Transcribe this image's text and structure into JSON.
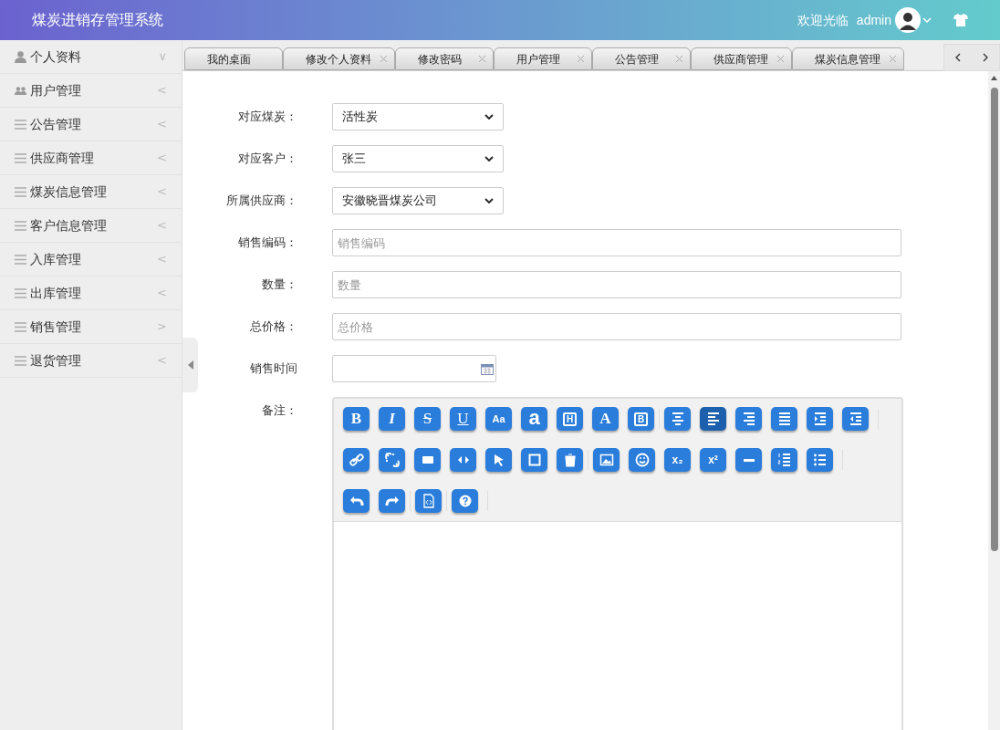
{
  "header": {
    "title": "煤炭进销存管理系统",
    "welcome": "欢迎光临",
    "username": "admin"
  },
  "sidebar": {
    "items": [
      {
        "kind": "user",
        "label": "个人资料",
        "chevron": "∨"
      },
      {
        "kind": "users",
        "label": "用户管理",
        "chevron": "<"
      },
      {
        "kind": "list",
        "label": "公告管理",
        "chevron": "<"
      },
      {
        "kind": "list",
        "label": "供应商管理",
        "chevron": "<"
      },
      {
        "kind": "list",
        "label": "煤炭信息管理",
        "chevron": "<"
      },
      {
        "kind": "list",
        "label": "客户信息管理",
        "chevron": "<"
      },
      {
        "kind": "list",
        "label": "入库管理",
        "chevron": "<"
      },
      {
        "kind": "list",
        "label": "出库管理",
        "chevron": "<"
      },
      {
        "kind": "list",
        "label": "销售管理",
        "chevron": ">"
      },
      {
        "kind": "list",
        "label": "退货管理",
        "chevron": "<"
      }
    ]
  },
  "tabs": [
    {
      "label": "我的桌面",
      "closable": false
    },
    {
      "label": "修改个人资料",
      "closable": true
    },
    {
      "label": "修改密码",
      "closable": true
    },
    {
      "label": "用户管理",
      "closable": true
    },
    {
      "label": "公告管理",
      "closable": true
    },
    {
      "label": "供应商管理",
      "closable": true
    },
    {
      "label": "煤炭信息管理",
      "closable": true
    }
  ],
  "form": {
    "fields": [
      {
        "kind": "select",
        "label": "对应煤炭：",
        "value": "活性炭"
      },
      {
        "kind": "select",
        "label": "对应客户：",
        "value": "张三"
      },
      {
        "kind": "select",
        "label": "所属供应商：",
        "value": "安徽晓晋煤炭公司"
      },
      {
        "kind": "input",
        "label": "销售编码：",
        "placeholder": "销售编码"
      },
      {
        "kind": "input",
        "label": "数量：",
        "placeholder": "数量"
      },
      {
        "kind": "input",
        "label": "总价格：",
        "placeholder": "总价格"
      },
      {
        "kind": "date",
        "label": "销售时间"
      },
      {
        "kind": "editor",
        "label": "备注："
      }
    ]
  },
  "editor": {
    "toolbar": [
      [
        [
          {
            "kind": "serif",
            "label": "B",
            "active": false
          },
          {
            "kind": "italic",
            "label": "I",
            "active": false
          },
          {
            "kind": "strike",
            "label": "S",
            "active": false
          },
          {
            "kind": "underline",
            "label": "U",
            "active": false
          },
          {
            "kind": "small",
            "label": "Aa",
            "active": false
          },
          {
            "kind": "big",
            "label": "a",
            "active": false
          },
          {
            "kind": "boxed",
            "label": "H",
            "active": false
          },
          {
            "kind": "serif",
            "label": "A",
            "active": false
          },
          {
            "kind": "boxed",
            "label": "B",
            "active": false
          }
        ],
        [
          {
            "kind": "align-center",
            "active": false
          },
          {
            "kind": "align-left",
            "active": true
          },
          {
            "kind": "align-right",
            "active": false
          },
          {
            "kind": "justify",
            "active": false
          },
          {
            "kind": "indent",
            "active": false
          },
          {
            "kind": "outdent",
            "active": false
          }
        ]
      ],
      [
        [
          {
            "kind": "link",
            "active": false
          },
          {
            "kind": "unlink",
            "active": false
          },
          {
            "kind": "embed",
            "active": false
          },
          {
            "kind": "code",
            "active": false
          },
          {
            "kind": "pointer",
            "active": false
          },
          {
            "kind": "square",
            "active": false
          },
          {
            "kind": "trash",
            "active": false
          }
        ],
        [
          {
            "kind": "image",
            "active": false
          },
          {
            "kind": "smiley",
            "active": false
          },
          {
            "kind": "sub",
            "label": "x₂",
            "active": false
          },
          {
            "kind": "sup",
            "label": "x²",
            "active": false
          },
          {
            "kind": "rule",
            "active": false
          },
          {
            "kind": "ol",
            "active": false
          },
          {
            "kind": "ul",
            "active": false
          }
        ]
      ],
      [
        [
          {
            "kind": "undo",
            "active": false
          },
          {
            "kind": "redo",
            "active": false
          }
        ],
        [
          {
            "kind": "file-code",
            "active": false
          }
        ],
        [
          {
            "kind": "help",
            "active": false
          }
        ]
      ]
    ]
  }
}
